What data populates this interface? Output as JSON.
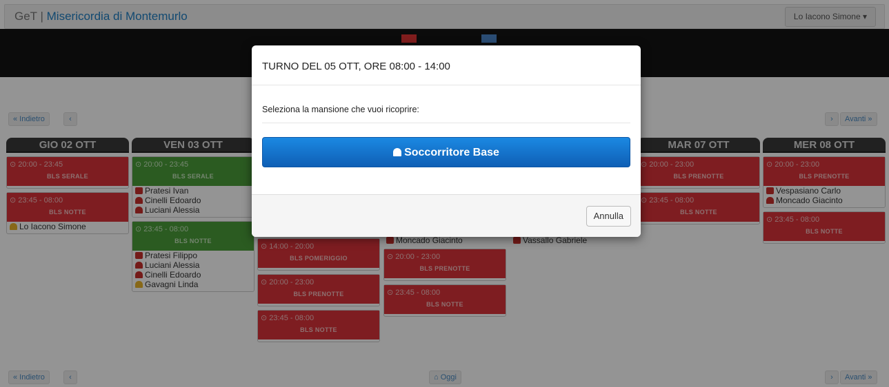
{
  "navbar": {
    "brand": "GeT",
    "separator": " | ",
    "org": "Misericordia di Montemurlo",
    "user": "Lo Iacono Simone"
  },
  "nav": {
    "back": "« Indietro",
    "prev": "‹",
    "next": "›",
    "forward": "Avanti »",
    "today": "Oggi"
  },
  "days": [
    {
      "label": "GIO 02 OTT",
      "shifts": [
        {
          "time": "20:00 - 23:45",
          "name": "BLS SERALE",
          "color": "red",
          "people": []
        },
        {
          "time": "23:45 - 08:00",
          "name": "BLS NOTTE",
          "color": "red",
          "people": [
            {
              "icon": "yel",
              "name": "Lo Iacono Simone"
            }
          ]
        }
      ]
    },
    {
      "label": "VEN 03 OTT",
      "shifts": [
        {
          "time": "20:00 - 23:45",
          "name": "BLS SERALE",
          "color": "green",
          "people": [
            {
              "icon": "amb",
              "name": "Pratesi Ivan"
            },
            {
              "icon": "usr",
              "name": "Cinelli Edoardo"
            },
            {
              "icon": "usr",
              "name": "Luciani Alessia"
            }
          ]
        },
        {
          "time": "23:45 - 08:00",
          "name": "BLS NOTTE",
          "color": "green",
          "people": [
            {
              "icon": "amb",
              "name": "Pratesi Filippo"
            },
            {
              "icon": "usr",
              "name": "Luciani Alessia"
            },
            {
              "icon": "usr",
              "name": "Cinelli Edoardo"
            },
            {
              "icon": "yel",
              "name": "Gavagni Linda"
            }
          ]
        }
      ]
    },
    {
      "label": "",
      "shifts": [
        {
          "time": "14:00 - 20:00",
          "name": "BLS POMERIGGIO",
          "color": "red",
          "people": []
        },
        {
          "time": "20:00 - 23:00",
          "name": "BLS PRENOTTE",
          "color": "red",
          "people": []
        },
        {
          "time": "23:45 - 08:00",
          "name": "BLS NOTTE",
          "color": "red",
          "people": []
        }
      ]
    },
    {
      "label": "",
      "shifts": [
        {
          "time": "",
          "name": "",
          "color": "none",
          "people": [
            {
              "icon": "amb",
              "name": "Moncado Giacinto"
            }
          ]
        },
        {
          "time": "20:00 - 23:00",
          "name": "BLS PRENOTTE",
          "color": "red",
          "people": []
        },
        {
          "time": "23:45 - 08:00",
          "name": "BLS NOTTE",
          "color": "red",
          "people": []
        }
      ]
    },
    {
      "label": "",
      "shifts": [
        {
          "time": "",
          "name": "",
          "color": "none",
          "people": [
            {
              "icon": "amb",
              "name": "Vassallo Gabriele"
            }
          ]
        }
      ]
    },
    {
      "label": "MAR 07 OTT",
      "shifts": [
        {
          "time": "20:00 - 23:00",
          "name": "BLS PRENOTTE",
          "color": "red",
          "people": []
        },
        {
          "time": "23:45 - 08:00",
          "name": "BLS NOTTE",
          "color": "red",
          "people": []
        }
      ]
    },
    {
      "label": "MER 08 OTT",
      "shifts": [
        {
          "time": "20:00 - 23:00",
          "name": "BLS PRENOTTE",
          "color": "red",
          "people": [
            {
              "icon": "amb",
              "name": "Vespasiano Carlo"
            },
            {
              "icon": "usr",
              "name": "Moncado Giacinto"
            }
          ]
        },
        {
          "time": "23:45 - 08:00",
          "name": "BLS NOTTE",
          "color": "red",
          "people": []
        }
      ]
    }
  ],
  "modal": {
    "title": "TURNO DEL 05 OTT, ORE 08:00 - 14:00",
    "prompt": "Seleziona la mansione che vuoi ricoprire:",
    "role_button": "Soccorritore Base",
    "cancel": "Annulla"
  }
}
